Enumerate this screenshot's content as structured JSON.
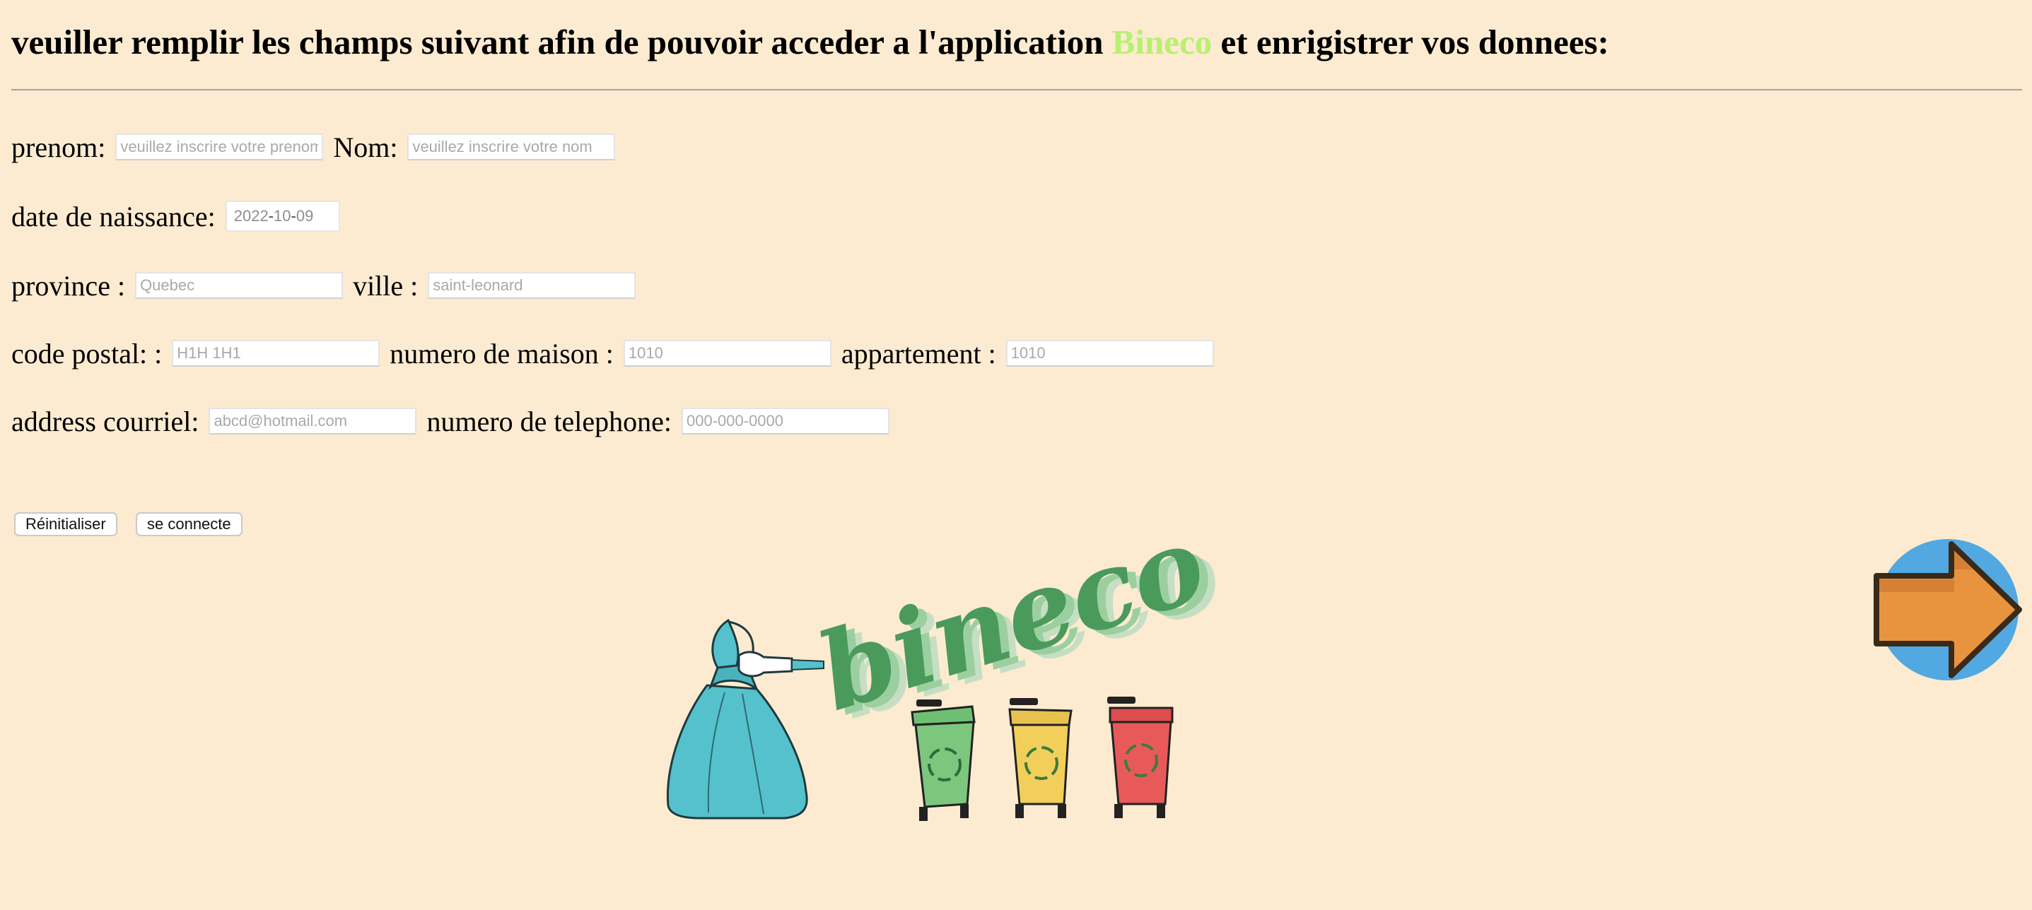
{
  "header": {
    "title_before": "veuiller remplir les champs suivant afin de pouvoir acceder a l'application",
    "brand": "Bineco",
    "title_after": "et enrigistrer vos donnees:",
    "brand_color": "#b8f070"
  },
  "form": {
    "prenom": {
      "label": "prenom:",
      "placeholder": "veuillez inscrire votre prenom"
    },
    "nom": {
      "label": "Nom:",
      "placeholder": "veuillez inscrire votre nom"
    },
    "date_naissance": {
      "label": "date de naissance:",
      "year": "2022",
      "month": "10",
      "day": "09"
    },
    "province": {
      "label": "province :",
      "placeholder": "Quebec"
    },
    "ville": {
      "label": "ville :",
      "placeholder": "saint-leonard"
    },
    "code_postal": {
      "label": "code postal: :",
      "placeholder": "H1H 1H1"
    },
    "numero_maison": {
      "label": "numero de maison :",
      "placeholder": "1010"
    },
    "appartement": {
      "label": "appartement :",
      "placeholder": "1010"
    },
    "courriel": {
      "label": "address courriel:",
      "placeholder": "abcd@hotmail.com"
    },
    "telephone": {
      "label": "numero de telephone:",
      "placeholder": "000-000-0000"
    }
  },
  "buttons": {
    "reset": "Réinitialiser",
    "submit": "se connecte"
  },
  "logo": {
    "text": "bineco",
    "icon": "bineco-logo",
    "colors": {
      "bag": "#55c1cc",
      "text": "#4a9a5c",
      "bin_green": "#7cc67e",
      "bin_yellow": "#f2cf5b",
      "bin_red": "#e85a5a"
    }
  },
  "navigation": {
    "next_icon": "right-arrow-icon",
    "circle_color": "#52a8e0",
    "arrow_color": "#e8943f"
  }
}
